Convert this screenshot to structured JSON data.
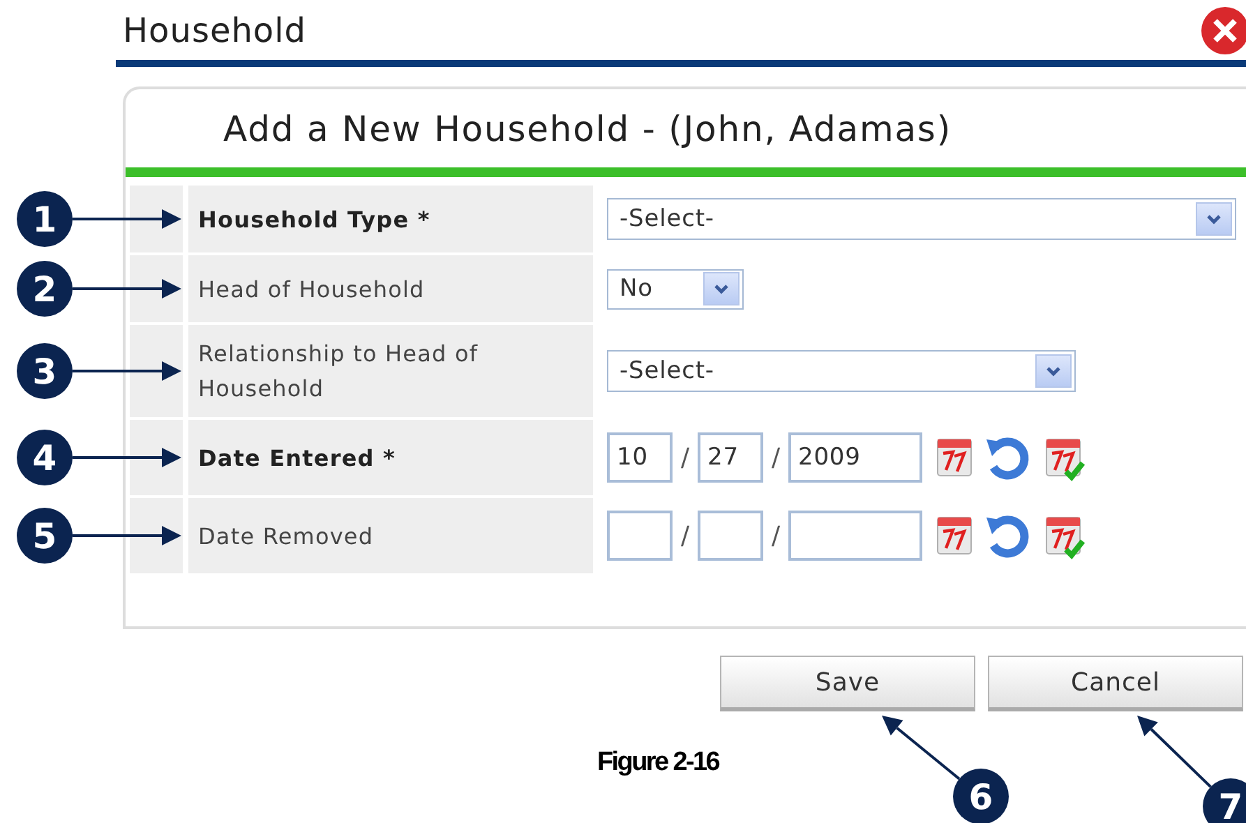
{
  "window": {
    "title": "Household"
  },
  "form": {
    "heading": "Add a New Household - (John, Adamas)",
    "fields": [
      {
        "kind": "select",
        "label": "Household Type",
        "required_mark": "*",
        "value": "-Select-",
        "callout": "1"
      },
      {
        "kind": "select",
        "label": "Head of Household",
        "value": "No",
        "callout": "2"
      },
      {
        "kind": "select",
        "label": "Relationship to Head of Household",
        "value": "-Select-",
        "callout": "3"
      },
      {
        "kind": "date",
        "label": "Date Entered",
        "required_mark": "*",
        "month": "10",
        "day": "27",
        "year": "2009",
        "separator": "/",
        "callout": "4"
      },
      {
        "kind": "date",
        "label": "Date Removed",
        "separator": "/",
        "callout": "5"
      }
    ]
  },
  "buttons": [
    {
      "label": "Save",
      "callout": "6"
    },
    {
      "label": "Cancel",
      "callout": "7"
    }
  ],
  "caption": "Figure 2-16"
}
